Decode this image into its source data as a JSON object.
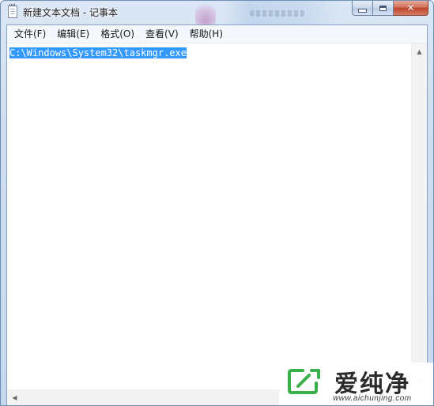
{
  "window": {
    "title": "新建文本文档 - 记事本",
    "caption_buttons": {
      "minimize": "minimize",
      "maximize": "maximize",
      "close": "✕"
    }
  },
  "menu": {
    "items": [
      {
        "label": "文件(F)"
      },
      {
        "label": "编辑(E)"
      },
      {
        "label": "格式(O)"
      },
      {
        "label": "查看(V)"
      },
      {
        "label": "帮助(H)"
      }
    ]
  },
  "editor": {
    "text": "C:\\Windows\\System32\\taskmgr.exe",
    "selected": true
  },
  "scrollbars": {
    "vertical": {
      "up_icon": "▲",
      "down_icon": "▼"
    },
    "horizontal": {
      "left_icon": "◀"
    }
  },
  "watermark": {
    "brand": "爱纯净",
    "url": "www.aichunjing.com"
  },
  "colors": {
    "selection": "#3399ff",
    "watermark_green": "#3ab04a"
  }
}
